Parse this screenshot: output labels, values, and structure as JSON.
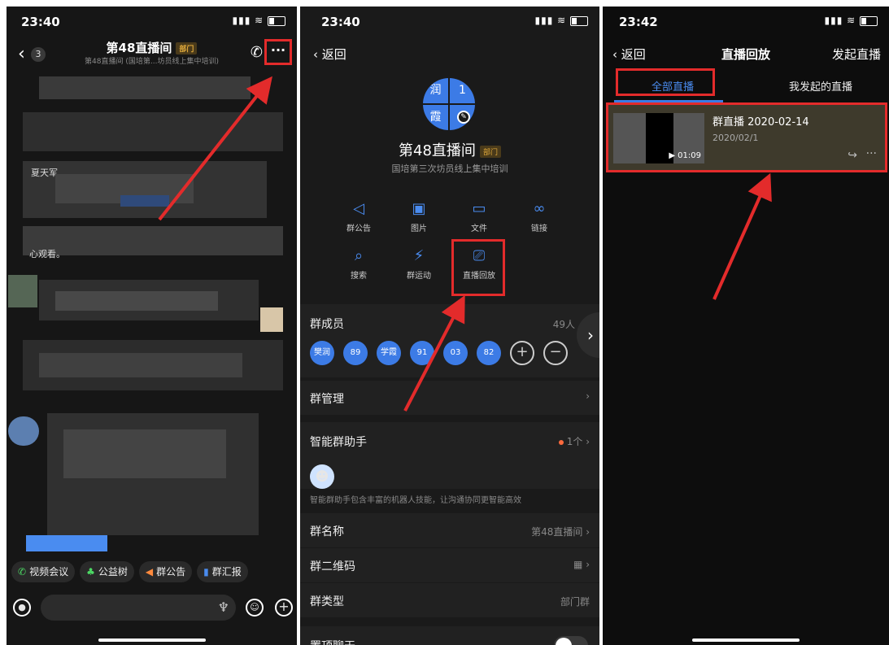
{
  "panel1": {
    "time": "23:40",
    "badge": "3",
    "title": "第48直播间",
    "dept_tag": "部门",
    "subtitle": "第48直播间 (国培第...坊员线上集中培训)",
    "more_label": "···",
    "msg1": "夏天军",
    "msg2": "心观看。",
    "chips": [
      {
        "icon": "video-meeting-icon",
        "label": "视频会议"
      },
      {
        "icon": "charity-tree-icon",
        "label": "公益树"
      },
      {
        "icon": "announcement-icon",
        "label": "群公告"
      },
      {
        "icon": "report-icon",
        "label": "群汇报"
      }
    ]
  },
  "panel2": {
    "time": "23:40",
    "back": "返回",
    "avatar_chars": [
      "润",
      "1",
      "霞",
      "1"
    ],
    "title": "第48直播间",
    "dept_tag": "部门",
    "subtitle": "国培第三次坊员线上集中培训",
    "grid": [
      {
        "icon": "megaphone-icon",
        "label": "群公告"
      },
      {
        "icon": "image-icon",
        "label": "图片"
      },
      {
        "icon": "folder-icon",
        "label": "文件"
      },
      {
        "icon": "link-icon",
        "label": "链接"
      },
      {
        "icon": "search-icon",
        "label": "搜索"
      },
      {
        "icon": "run-icon",
        "label": "群运动"
      },
      {
        "icon": "tv-icon",
        "label": "直播回放"
      }
    ],
    "members_label": "群成员",
    "members_count": "49人",
    "members": [
      "樊润",
      "89",
      "学霞",
      "91",
      "03",
      "82"
    ],
    "manage_label": "群管理",
    "assistant_label": "智能群助手",
    "assistant_count": "1个",
    "assistant_note": "智能群助手包含丰富的机器人技能，让沟通协同更智能高效",
    "group_name_label": "群名称",
    "group_name_value": "第48直播间",
    "qr_label": "群二维码",
    "type_label": "群类型",
    "type_value": "部门群",
    "pin_label": "置顶聊天"
  },
  "panel3": {
    "time": "23:42",
    "back": "返回",
    "title": "直播回放",
    "right": "发起直播",
    "tab_all": "全部直播",
    "tab_mine": "我发起的直播",
    "card_title": "群直播 2020-02-14",
    "card_date": "2020/02/1",
    "duration": "▶ 01:09"
  },
  "colors": {
    "accent": "#3c7be6",
    "highlight": "#e32b2b",
    "tag": "#e0a93b"
  }
}
